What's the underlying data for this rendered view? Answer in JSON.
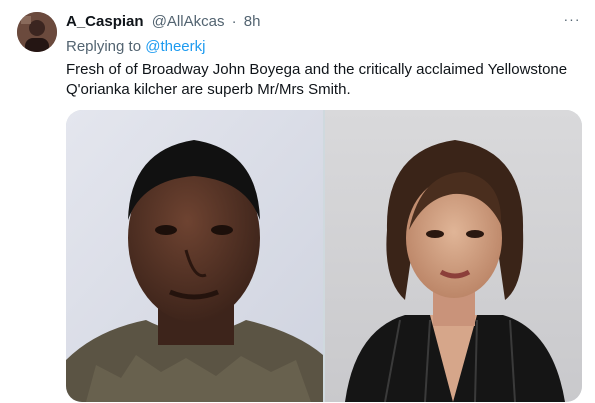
{
  "tweet": {
    "display_name": "A_Caspian",
    "handle": "@AllAkcas",
    "separator": "·",
    "time": "8h",
    "more_label": "···",
    "replying_prefix": "Replying to",
    "replying_to": "@theerkj",
    "text_line1": "Fresh of of Broadway John Boyega  and the critically acclaimed Yellowstone",
    "text_line2": "Q'orianka kilcher are superb Mr/Mrs Smith."
  },
  "colors": {
    "text_primary": "#0f1419",
    "text_secondary": "#536471",
    "link": "#1d9bf0",
    "background": "#ffffff"
  },
  "icons": {
    "more": "more-horizontal-icon"
  }
}
